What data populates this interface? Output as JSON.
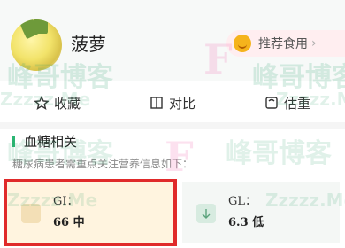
{
  "food": {
    "name": "菠萝",
    "image_icon": "pineapple-image"
  },
  "recommend": {
    "label": "推荐食用",
    "icon": "smile-icon",
    "chevron": "›"
  },
  "actions": [
    {
      "label": "收藏",
      "icon": "star-icon"
    },
    {
      "label": "对比",
      "icon": "compare-icon"
    },
    {
      "label": "估重",
      "icon": "scale-icon"
    }
  ],
  "blood_sugar": {
    "title": "血糖相关",
    "subtitle": "糖尿病患者需重点关注营养信息如下：",
    "gi": {
      "label": "GI：",
      "value": "66 中"
    },
    "gl": {
      "label": "GL：",
      "value": "6.3 低"
    }
  },
  "watermark": {
    "text": "峰哥博客",
    "code": "Zzzzz.Me",
    "letter": "F"
  },
  "colors": {
    "accent": "#2bb673",
    "highlight": "#e02a2a",
    "recommend_bg": "#ffeef0",
    "gi_bg": "#fff4df"
  }
}
